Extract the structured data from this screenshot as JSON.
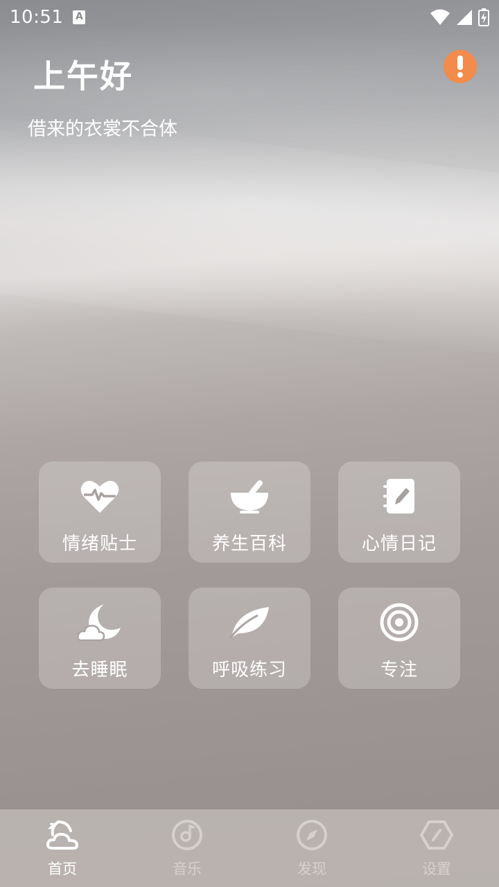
{
  "status_bar": {
    "time": "10:51",
    "notification_icon": "a-box-icon",
    "wifi_icon": "wifi-icon",
    "signal_icon": "signal-icon",
    "battery_icon": "battery-charging-icon"
  },
  "header": {
    "greeting": "上午好",
    "subtitle": "借来的衣裳不合体",
    "alert_icon": "exclamation-icon",
    "alert_color": "#f28b4b"
  },
  "features": [
    {
      "label": "情绪贴士",
      "icon": "heart-pulse-icon"
    },
    {
      "label": "养生百科",
      "icon": "mortar-pestle-icon"
    },
    {
      "label": "心情日记",
      "icon": "notebook-pen-icon"
    },
    {
      "label": "去睡眠",
      "icon": "moon-cloud-icon"
    },
    {
      "label": "呼吸练习",
      "icon": "leaf-icon"
    },
    {
      "label": "专注",
      "icon": "target-icon"
    }
  ],
  "tabs": [
    {
      "label": "首页",
      "icon": "home-moon-cloud-icon",
      "active": true
    },
    {
      "label": "音乐",
      "icon": "music-disc-icon",
      "active": false
    },
    {
      "label": "发现",
      "icon": "compass-icon",
      "active": false
    },
    {
      "label": "设置",
      "icon": "hexagon-settings-icon",
      "active": false
    }
  ]
}
